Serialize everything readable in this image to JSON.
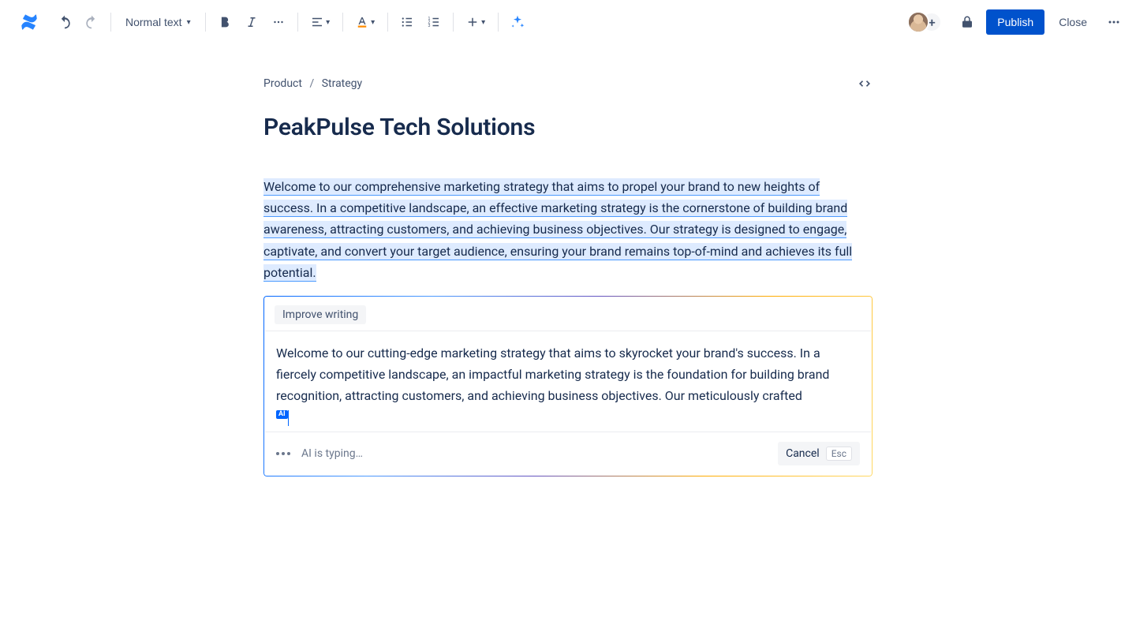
{
  "toolbar": {
    "text_style": "Normal text",
    "publish_label": "Publish",
    "close_label": "Close"
  },
  "breadcrumb": {
    "parent": "Product",
    "current": "Strategy"
  },
  "page": {
    "title": "PeakPulse Tech Solutions",
    "paragraph": "Welcome to our comprehensive marketing strategy that aims to propel your brand to new heights of success. In a competitive landscape, an effective marketing strategy is the cornerstone of building brand awareness, attracting customers, and achieving business objectives. Our strategy is designed to engage, captivate, and convert your target audience, ensuring your brand remains top-of-mind and achieves its full potential."
  },
  "ai": {
    "chip_label": "Improve writing",
    "draft": "Welcome to our cutting-edge marketing strategy that aims to skyrocket your brand's success. In a fiercely competitive landscape, an impactful marketing strategy is the foundation for building brand recognition, attracting customers, and achieving business objectives. Our meticulously crafted",
    "badge": "AI",
    "status": "AI is typing…",
    "cancel_label": "Cancel",
    "esc_label": "Esc"
  }
}
